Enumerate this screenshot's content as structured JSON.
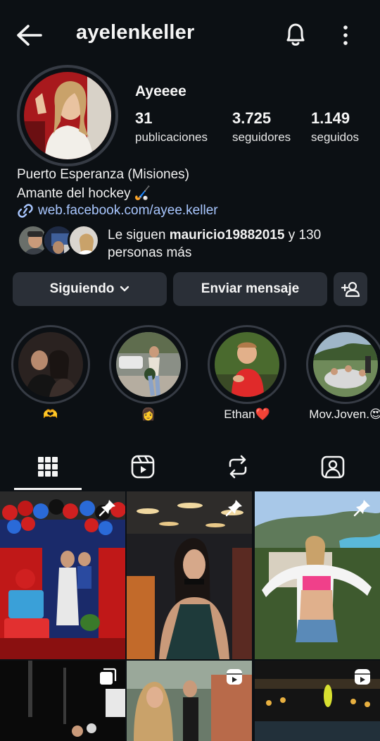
{
  "header": {
    "username": "ayelenkeller",
    "icons": [
      "back-arrow-icon",
      "bell-icon",
      "more-vertical-icon"
    ]
  },
  "profile": {
    "display_name": "Ayeeee",
    "stats": [
      {
        "value": "31",
        "label": "publicaciones"
      },
      {
        "value": "3.725",
        "label": "seguidores"
      },
      {
        "value": "1.149",
        "label": "seguidos"
      }
    ],
    "bio": [
      "Puerto Esperanza (Misiones)",
      "Amante del hockey 🏑"
    ],
    "link": "web.facebook.com/ayee.keller",
    "followed_by": {
      "prefix": "Le siguen ",
      "user": "mauricio19882015",
      "suffix": " y 130 personas más"
    }
  },
  "actions": {
    "following_label": "Siguiendo",
    "message_label": "Enviar mensaje"
  },
  "highlights": [
    {
      "label": "🫶"
    },
    {
      "label": "👩"
    },
    {
      "label": "Ethan❤️"
    },
    {
      "label": "Mov.Joven.😍"
    }
  ],
  "tabs": [
    "grid-icon",
    "reels-icon",
    "reposts-icon",
    "tagged-icon"
  ],
  "colors": {
    "background": "#0c1014",
    "button": "#2a2f37",
    "link": "#a9c7ff",
    "ring": "#363b44"
  }
}
